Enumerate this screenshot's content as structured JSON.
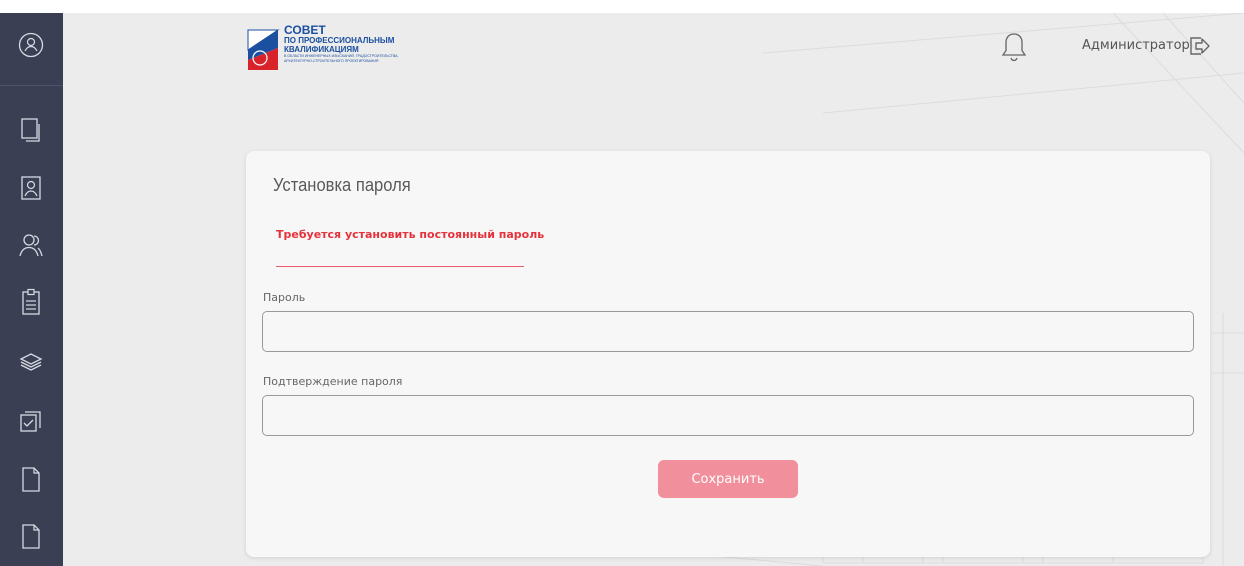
{
  "header": {
    "logo": {
      "line1": "СОВЕТ",
      "line2": "ПО ПРОФЕССИОНАЛЬНЫМ",
      "line3": "КВАЛИФИКАЦИЯМ",
      "line4": "В ОБЛАСТИ ИНЖЕНЕРНЫХ ИЗЫСКАНИЙ, ГРАДОСТРОИТЕЛЬСТВА,",
      "line5": "АРХИТЕКТУРНО-СТРОИТЕЛЬНОГО ПРОЕКТИРОВАНИЯ"
    },
    "user_name": "Администратор",
    "icons": {
      "bell": "bell-icon",
      "logout": "logout-icon"
    }
  },
  "sidebar": {
    "items": [
      {
        "icon": "user-circle-icon"
      },
      {
        "icon": "documents-icon"
      },
      {
        "icon": "user-card-icon"
      },
      {
        "icon": "users-icon"
      },
      {
        "icon": "clipboard-icon"
      },
      {
        "icon": "layers-icon"
      },
      {
        "icon": "checked-stack-icon"
      },
      {
        "icon": "file-icon"
      },
      {
        "icon": "file-icon"
      }
    ]
  },
  "form": {
    "title": "Установка пароля",
    "warning": "Требуется установить постоянный пароль",
    "password_label": "Пароль",
    "password_value": "",
    "confirm_label": "Подтверждение пароля",
    "confirm_value": "",
    "save_label": "Сохранить"
  },
  "colors": {
    "sidebar": "#3a3f54",
    "warning": "#e6323c",
    "button": "#f28f9c",
    "logo_blue": "#1b4fa0"
  }
}
